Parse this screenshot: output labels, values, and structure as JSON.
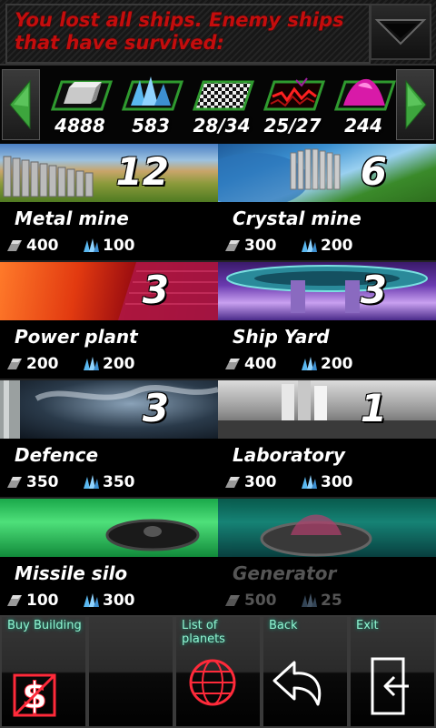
{
  "message": {
    "text": "You lost all ships. Enemy ships that have survived:"
  },
  "resources": [
    {
      "icon": "metal-icon",
      "value": "4888"
    },
    {
      "icon": "crystal-icon",
      "value": "583"
    },
    {
      "icon": "checker-icon",
      "value": "28/34"
    },
    {
      "icon": "energy-icon",
      "value": "25/27"
    },
    {
      "icon": "pink-crystal-icon",
      "value": "244"
    }
  ],
  "buildings": [
    {
      "name": "Metal mine",
      "count": "12",
      "metal": "400",
      "crystal": "100",
      "enabled": true
    },
    {
      "name": "Crystal mine",
      "count": "6",
      "metal": "300",
      "crystal": "200",
      "enabled": true
    },
    {
      "name": "Power plant",
      "count": "3",
      "metal": "200",
      "crystal": "200",
      "enabled": true
    },
    {
      "name": "Ship Yard",
      "count": "3",
      "metal": "400",
      "crystal": "200",
      "enabled": true
    },
    {
      "name": "Defence",
      "count": "3",
      "metal": "350",
      "crystal": "350",
      "enabled": true
    },
    {
      "name": "Laboratory",
      "count": "1",
      "metal": "300",
      "crystal": "300",
      "enabled": true
    },
    {
      "name": "Missile silo",
      "count": "",
      "metal": "100",
      "crystal": "300",
      "enabled": true
    },
    {
      "name": "Generator",
      "count": "",
      "metal": "500",
      "crystal": "25",
      "enabled": false
    }
  ],
  "toolbar": {
    "buy_label": "Buy Building",
    "planets_label": "List of planets",
    "back_label": "Back",
    "exit_label": "Exit"
  },
  "colors": {
    "message": "#c40d0d",
    "toolbar_text": "#8ff4d0",
    "accent_green": "#3da53d"
  }
}
